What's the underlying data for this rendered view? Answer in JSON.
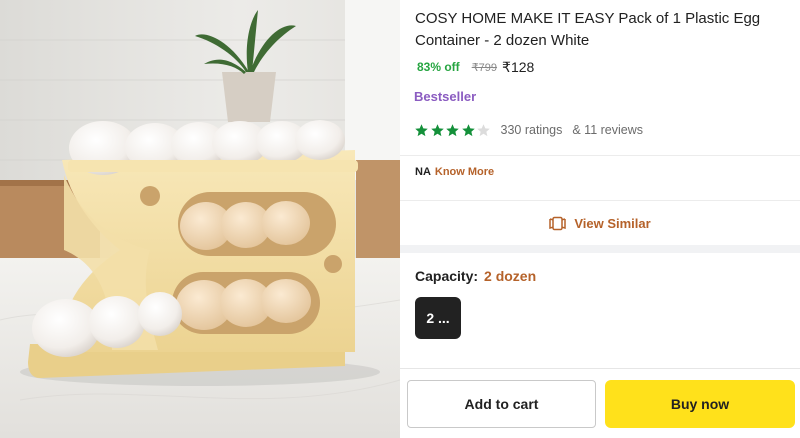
{
  "product": {
    "title": "COSY HOME MAKE IT EASY Pack of 1 Plastic Egg Container  - 2 dozen White",
    "discount": "83% off",
    "mrp": "₹799",
    "price": "₹128",
    "badge": "Bestseller",
    "rating": {
      "stars": 4,
      "out_of": 5,
      "ratings_text": "330 ratings",
      "reviews_text": "& 11 reviews"
    },
    "na_label": "NA",
    "know_more_label": "Know More"
  },
  "view_similar": {
    "label": "View Similar",
    "icon": "view-similar-icon"
  },
  "capacity": {
    "label": "Capacity:",
    "value": "2 dozen",
    "option_label": "2 ..."
  },
  "actions": {
    "add_to_cart": "Add to cart",
    "buy_now": "Buy now"
  },
  "colors": {
    "discount_green": "#26a541",
    "bestseller_purple": "#8b5cc1",
    "accent_orange": "#b5622a",
    "star_green": "#14903a",
    "buy_now_yellow": "#ffe11b"
  }
}
